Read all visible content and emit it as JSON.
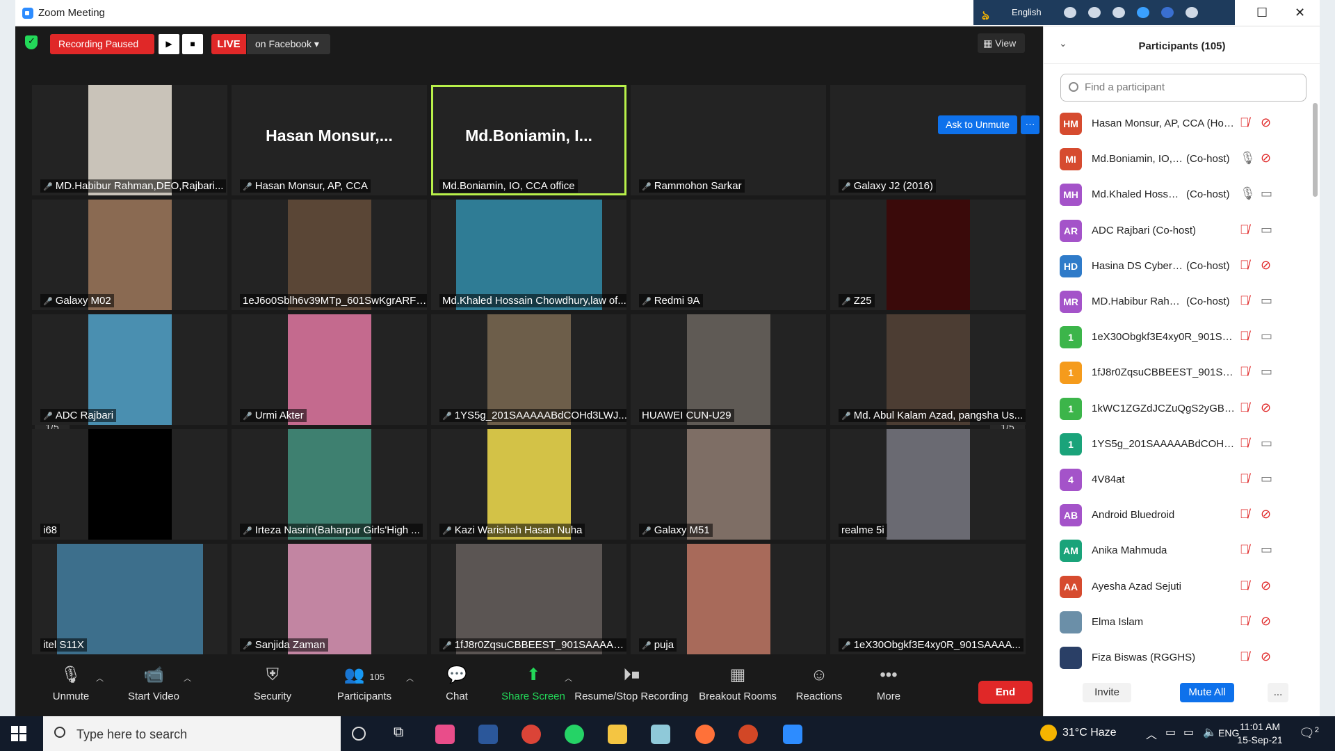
{
  "window": {
    "title": "Zoom Meeting"
  },
  "lang_bar": {
    "language": "English"
  },
  "top": {
    "recording_status": "Recording Paused",
    "live_label": "LIVE",
    "live_target": "on Facebook",
    "view_label": "View",
    "ask_unmute": "Ask to Unmute",
    "tile_more": "···"
  },
  "tiles": [
    {
      "name": "MD.Habibur Rahman,DEO,Rajbari...",
      "muted": true,
      "video": "#c9c3b9"
    },
    {
      "name": "Hasan Monsur, AP, CCA",
      "big": "Hasan  Monsur,...",
      "muted": true
    },
    {
      "name": "Md.Boniamin, IO, CCA office",
      "big": "Md.Boniamin,  I...",
      "muted": false,
      "active": true
    },
    {
      "name": "Rammohon Sarkar",
      "muted": true
    },
    {
      "name": "Galaxy J2 (2016)",
      "muted": true
    },
    {
      "name": "Galaxy M02",
      "muted": true,
      "video": "#8a6a52"
    },
    {
      "name": "1eJ6o0Sblh6v39MTp_601SwKgrARFB...",
      "muted": false,
      "video": "#5a4636"
    },
    {
      "name": "Md.Khaled Hossain Chowdhury,law of...",
      "muted": false,
      "video": "#2f7c95"
    },
    {
      "name": "Redmi 9A",
      "muted": true
    },
    {
      "name": "Z25",
      "muted": true,
      "video": "#3a0a0a"
    },
    {
      "name": "ADC Rajbari",
      "muted": true,
      "video": "#4a8fb0"
    },
    {
      "name": "Urmi Akter",
      "muted": true,
      "video": "#c46a8e"
    },
    {
      "name": "1YS5g_201SAAAAABdCOHd3LWJ...",
      "muted": true,
      "video": "#6d5e4a"
    },
    {
      "name": "HUAWEI CUN-U29",
      "muted": false,
      "video": "#5f5a55"
    },
    {
      "name": "Md. Abul Kalam Azad, pangsha Us...",
      "muted": true,
      "video": "#4c3d33"
    },
    {
      "name": "i68",
      "muted": false,
      "video": "#000000"
    },
    {
      "name": "Irteza Nasrin(Baharpur Girls'High ...",
      "muted": true,
      "video": "#3e8070"
    },
    {
      "name": "Kazi Warishah Hasan Nuha",
      "muted": true,
      "video": "#d3c247"
    },
    {
      "name": "Galaxy M51",
      "muted": true,
      "video": "#7e6e65"
    },
    {
      "name": "realme 5i",
      "muted": false,
      "video": "#6a6a72"
    },
    {
      "name": "itel S11X",
      "muted": false,
      "video": "#3d6f8c"
    },
    {
      "name": "Sanjida Zaman",
      "muted": true,
      "video": "#c285a2"
    },
    {
      "name": "1fJ8r0ZqsuCBBEEST_901SAAAAA...",
      "muted": true,
      "video": "#5b5553"
    },
    {
      "name": "puja",
      "muted": true,
      "video": "#a86a5a"
    },
    {
      "name": "1eX30Obgkf3E4xy0R_901SAAAA...",
      "muted": true
    }
  ],
  "pager": {
    "left": "1/5",
    "right": "1/5"
  },
  "toolbar": {
    "unmute": "Unmute",
    "start_video": "Start Video",
    "security": "Security",
    "participants": "Participants",
    "participants_count": "105",
    "chat": "Chat",
    "share_screen": "Share Screen",
    "recording": "Resume/Stop Recording",
    "breakout": "Breakout Rooms",
    "reactions": "Reactions",
    "more": "More",
    "end": "End"
  },
  "panel": {
    "title": "Participants (105)",
    "search_placeholder": "Find a participant",
    "invite": "Invite",
    "mute_all": "Mute All",
    "more": "...",
    "participants": [
      {
        "initials": "HM",
        "color": "#d64b2f",
        "name": "Hasan Monsur, AP, CCA (Host, me)",
        "role": "",
        "mic_on": false,
        "cam_on": false
      },
      {
        "initials": "MI",
        "color": "#d64b2f",
        "name": "Md.Boniamin, IO, CCA ...",
        "role": "(Co-host)",
        "mic_on": true,
        "cam_on": false
      },
      {
        "initials": "MH",
        "color": "#a453c9",
        "name": "Md.Khaled Hossain Ch...",
        "role": "(Co-host)",
        "mic_on": true,
        "cam_on": true
      },
      {
        "initials": "AR",
        "color": "#a453c9",
        "name": "ADC Rajbari (Co-host)",
        "role": "",
        "mic_on": false,
        "cam_on": true
      },
      {
        "initials": "HD",
        "color": "#2f7bc9",
        "name": "Hasina DS Cyber CCA I...",
        "role": "(Co-host)",
        "mic_on": false,
        "cam_on": false
      },
      {
        "initials": "MR",
        "color": "#a453c9",
        "name": "MD.Habibur Rahman,D...",
        "role": "(Co-host)",
        "mic_on": false,
        "cam_on": true
      },
      {
        "initials": "1",
        "color": "#3cb54a",
        "name": "1eX30Obgkf3E4xy0R_901SAAAA...",
        "role": "",
        "mic_on": false,
        "cam_on": true
      },
      {
        "initials": "1",
        "color": "#f59b1c",
        "name": "1fJ8r0ZqsuCBBEEST_901SAAAAA...",
        "role": "",
        "mic_on": false,
        "cam_on": true
      },
      {
        "initials": "1",
        "color": "#3cb54a",
        "name": "1kWC1ZGZdJCZuQgS2yGB_901S...",
        "role": "",
        "mic_on": false,
        "cam_on": false
      },
      {
        "initials": "1",
        "color": "#1aa37a",
        "name": "1YS5g_201SAAAAABdCOHd3LW...",
        "role": "",
        "mic_on": false,
        "cam_on": true
      },
      {
        "initials": "4",
        "color": "#a453c9",
        "name": "4V84at",
        "role": "",
        "mic_on": false,
        "cam_on": true
      },
      {
        "initials": "AB",
        "color": "#a453c9",
        "name": "Android Bluedroid",
        "role": "",
        "mic_on": false,
        "cam_on": false
      },
      {
        "initials": "AM",
        "color": "#1aa37a",
        "name": "Anika Mahmuda",
        "role": "",
        "mic_on": false,
        "cam_on": true
      },
      {
        "initials": "AA",
        "color": "#d64b2f",
        "name": "Ayesha Azad Sejuti",
        "role": "",
        "mic_on": false,
        "cam_on": false
      },
      {
        "initials": "",
        "color": "#6b8fa8",
        "name": "Elma Islam",
        "role": "",
        "mic_on": false,
        "cam_on": false
      },
      {
        "initials": "",
        "color": "#2a3f66",
        "name": "Fiza Biswas (RGGHS)",
        "role": "",
        "mic_on": false,
        "cam_on": false
      }
    ]
  },
  "taskbar": {
    "search_placeholder": "Type here to search",
    "weather": "31°C  Haze",
    "lang": "ENG",
    "time": "11:01 AM",
    "date": "15-Sep-21",
    "notifications": "2"
  }
}
